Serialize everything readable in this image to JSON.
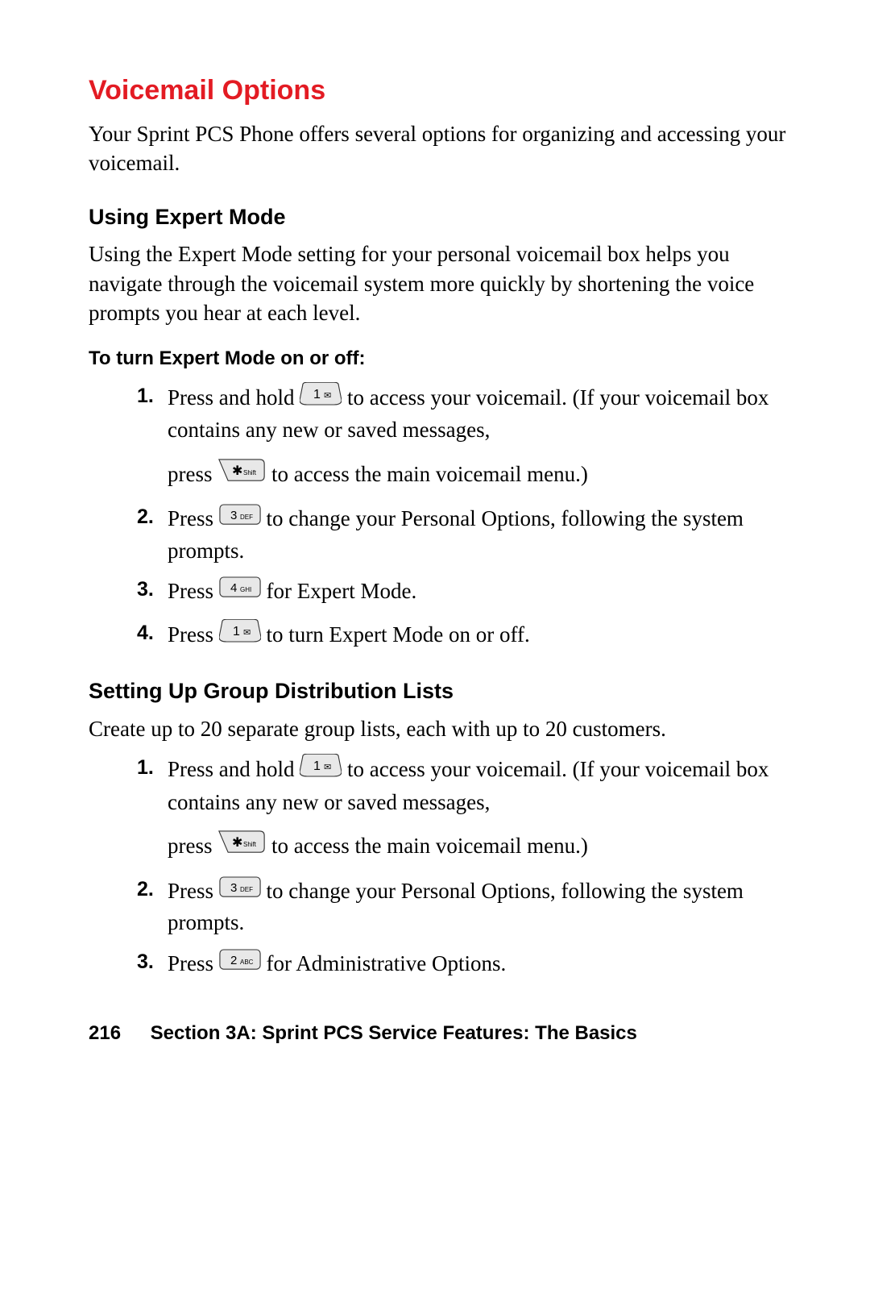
{
  "title": "Voicemail Options",
  "intro": "Your Sprint PCS Phone offers several options for organizing and accessing your voicemail.",
  "section1": {
    "heading": "Using Expert Mode",
    "body": "Using the Expert Mode setting for your personal voicemail box helps you navigate through the voicemail system more quickly by shortening the voice prompts you hear at each level.",
    "subhead": "To turn Expert Mode on or off:",
    "steps": {
      "s1": {
        "n": "1.",
        "a": "Press and hold ",
        "b": " to access your voicemail. (If your voicemail box contains any new or saved messages,",
        "c": "press ",
        "d": " to access the main voicemail menu.)"
      },
      "s2": {
        "n": "2.",
        "a": "Press ",
        "b": " to change your Personal Options, following the system prompts."
      },
      "s3": {
        "n": "3.",
        "a": "Press ",
        "b": " for Expert Mode."
      },
      "s4": {
        "n": "4.",
        "a": "Press ",
        "b": " to turn Expert Mode on or off."
      }
    }
  },
  "section2": {
    "heading": "Setting Up Group Distribution Lists",
    "body": "Create up to 20 separate group lists, each with up to 20 customers.",
    "steps": {
      "s1": {
        "n": "1.",
        "a": "Press and hold ",
        "b": " to access your voicemail. (If your voicemail box contains any new or saved messages,",
        "c": "press ",
        "d": " to access the main voicemail menu.)"
      },
      "s2": {
        "n": "2.",
        "a": "Press ",
        "b": " to change your Personal Options, following the system prompts."
      },
      "s3": {
        "n": "3.",
        "a": "Press ",
        "b": " for Administrative Options."
      }
    }
  },
  "footer": {
    "page": "216",
    "text": "Section 3A: Sprint PCS Service Features: The Basics"
  },
  "keys": {
    "one": {
      "digit": "1",
      "sub": "✉"
    },
    "two": {
      "digit": "2",
      "sub": "ABC"
    },
    "three": {
      "digit": "3",
      "sub": "DEF"
    },
    "four": {
      "digit": "4",
      "sub": "GHI"
    },
    "star": {
      "digit": "✱",
      "sub": "Shift"
    }
  }
}
